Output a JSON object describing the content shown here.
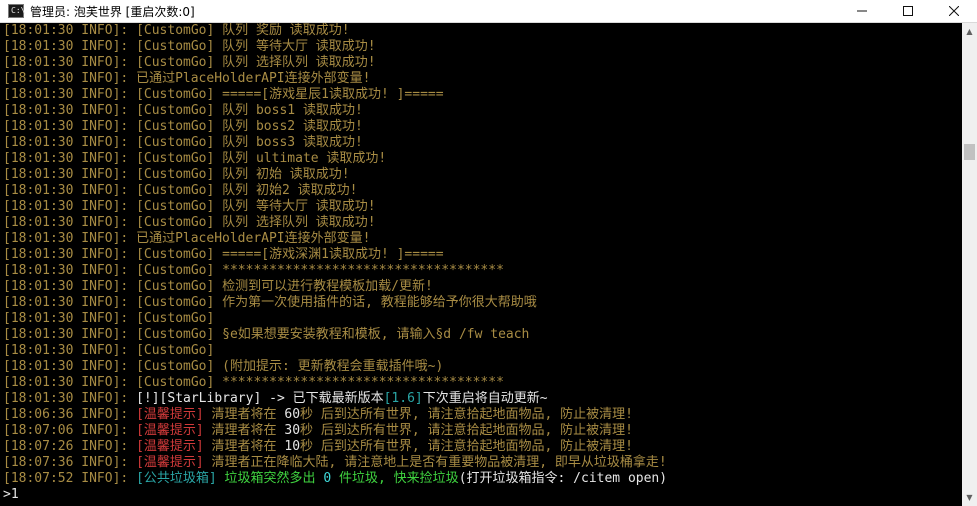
{
  "window": {
    "title": "管理员:  泡芙世界 [重启次数:0]",
    "icon": "cmd-console-icon",
    "controls": [
      "minimize",
      "maximize",
      "close"
    ]
  },
  "colors": {
    "timestamp": "#a88c44",
    "gold": "#a88c44",
    "white": "#e6e6e6",
    "cyan": "#2aa6a6",
    "green": "#3fd23f",
    "red": "#d03a3a",
    "bright_cyan": "#3fd8d8"
  },
  "console": {
    "lines": [
      {
        "ts": "[18:01:30 INFO]: ",
        "segs": [
          {
            "t": "[CustomGo] 队列 奖励 读取成功!",
            "c": "gold"
          }
        ]
      },
      {
        "ts": "[18:01:30 INFO]: ",
        "segs": [
          {
            "t": "[CustomGo] 队列 等待大厅 读取成功!",
            "c": "gold"
          }
        ]
      },
      {
        "ts": "[18:01:30 INFO]: ",
        "segs": [
          {
            "t": "[CustomGo] 队列 选择队列 读取成功!",
            "c": "gold"
          }
        ]
      },
      {
        "ts": "[18:01:30 INFO]: ",
        "segs": [
          {
            "t": "已通过PlaceHolderAPI连接外部变量!",
            "c": "gold"
          }
        ]
      },
      {
        "ts": "[18:01:30 INFO]: ",
        "segs": [
          {
            "t": "[CustomGo] =====[游戏星辰1读取成功! ]=====",
            "c": "gold"
          }
        ]
      },
      {
        "ts": "[18:01:30 INFO]: ",
        "segs": [
          {
            "t": "[CustomGo] 队列 boss1 读取成功!",
            "c": "gold"
          }
        ]
      },
      {
        "ts": "[18:01:30 INFO]: ",
        "segs": [
          {
            "t": "[CustomGo] 队列 boss2 读取成功!",
            "c": "gold"
          }
        ]
      },
      {
        "ts": "[18:01:30 INFO]: ",
        "segs": [
          {
            "t": "[CustomGo] 队列 boss3 读取成功!",
            "c": "gold"
          }
        ]
      },
      {
        "ts": "[18:01:30 INFO]: ",
        "segs": [
          {
            "t": "[CustomGo] 队列 ultimate 读取成功!",
            "c": "gold"
          }
        ]
      },
      {
        "ts": "[18:01:30 INFO]: ",
        "segs": [
          {
            "t": "[CustomGo] 队列 初始 读取成功!",
            "c": "gold"
          }
        ]
      },
      {
        "ts": "[18:01:30 INFO]: ",
        "segs": [
          {
            "t": "[CustomGo] 队列 初始2 读取成功!",
            "c": "gold"
          }
        ]
      },
      {
        "ts": "[18:01:30 INFO]: ",
        "segs": [
          {
            "t": "[CustomGo] 队列 等待大厅 读取成功!",
            "c": "gold"
          }
        ]
      },
      {
        "ts": "[18:01:30 INFO]: ",
        "segs": [
          {
            "t": "[CustomGo] 队列 选择队列 读取成功!",
            "c": "gold"
          }
        ]
      },
      {
        "ts": "[18:01:30 INFO]: ",
        "segs": [
          {
            "t": "已通过PlaceHolderAPI连接外部变量!",
            "c": "gold"
          }
        ]
      },
      {
        "ts": "[18:01:30 INFO]: ",
        "segs": [
          {
            "t": "[CustomGo] =====[游戏深渊1读取成功! ]=====",
            "c": "gold"
          }
        ]
      },
      {
        "ts": "[18:01:30 INFO]: ",
        "segs": [
          {
            "t": "[CustomGo] ",
            "c": "gold"
          },
          {
            "t": "************************************",
            "c": "gold"
          }
        ]
      },
      {
        "ts": "[18:01:30 INFO]: ",
        "segs": [
          {
            "t": "[CustomGo] ",
            "c": "gold"
          },
          {
            "t": "检测到可以进行教程模板加载/更新!",
            "c": "gold"
          }
        ]
      },
      {
        "ts": "[18:01:30 INFO]: ",
        "segs": [
          {
            "t": "[CustomGo] ",
            "c": "gold"
          },
          {
            "t": "作为第一次使用插件的话, 教程能够给予你很大帮助哦",
            "c": "gold"
          }
        ]
      },
      {
        "ts": "[18:01:30 INFO]: ",
        "segs": [
          {
            "t": "[CustomGo]",
            "c": "gold"
          }
        ]
      },
      {
        "ts": "[18:01:30 INFO]: ",
        "segs": [
          {
            "t": "[CustomGo] ",
            "c": "gold"
          },
          {
            "t": "§e如果想要安装教程和模板, 请输入§d /fw teach",
            "c": "gold"
          }
        ]
      },
      {
        "ts": "[18:01:30 INFO]: ",
        "segs": [
          {
            "t": "[CustomGo]",
            "c": "gold"
          }
        ]
      },
      {
        "ts": "[18:01:30 INFO]: ",
        "segs": [
          {
            "t": "[CustomGo] ",
            "c": "gold"
          },
          {
            "t": "(附加提示: 更新教程会重载插件哦~)",
            "c": "gold"
          }
        ]
      },
      {
        "ts": "[18:01:30 INFO]: ",
        "segs": [
          {
            "t": "[CustomGo] ",
            "c": "gold"
          },
          {
            "t": "************************************",
            "c": "gold"
          }
        ]
      },
      {
        "ts": "[18:01:30 INFO]: ",
        "segs": [
          {
            "t": "[!][StarLibrary] -> 已下载最新版本",
            "c": "white"
          },
          {
            "t": "[1.6]",
            "c": "cyan"
          },
          {
            "t": "下次重启将自动更新~",
            "c": "white"
          }
        ]
      },
      {
        "ts": "[18:06:36 INFO]: ",
        "segs": [
          {
            "t": "[温馨提示]",
            "c": "red"
          },
          {
            "t": " 清理者将在 ",
            "c": "gold"
          },
          {
            "t": "60",
            "c": "white"
          },
          {
            "t": "秒 后到达所有世界, 请注意拾起地面物品, 防止被清理!",
            "c": "gold"
          }
        ]
      },
      {
        "ts": "[18:07:06 INFO]: ",
        "segs": [
          {
            "t": "[温馨提示]",
            "c": "red"
          },
          {
            "t": " 清理者将在 ",
            "c": "gold"
          },
          {
            "t": "30",
            "c": "white"
          },
          {
            "t": "秒 后到达所有世界, 请注意拾起地面物品, 防止被清理!",
            "c": "gold"
          }
        ]
      },
      {
        "ts": "[18:07:26 INFO]: ",
        "segs": [
          {
            "t": "[温馨提示]",
            "c": "red"
          },
          {
            "t": " 清理者将在 ",
            "c": "gold"
          },
          {
            "t": "10",
            "c": "white"
          },
          {
            "t": "秒 后到达所有世界, 请注意拾起地面物品, 防止被清理!",
            "c": "gold"
          }
        ]
      },
      {
        "ts": "[18:07:36 INFO]: ",
        "segs": [
          {
            "t": "[温馨提示]",
            "c": "red"
          },
          {
            "t": " 清理者正在降临大陆, 请注意地上是否有重要物品被清理, 即早从垃圾桶拿走!",
            "c": "gold"
          }
        ]
      },
      {
        "ts": "[18:07:52 INFO]: ",
        "segs": [
          {
            "t": "[公共垃圾箱]",
            "c": "cyan"
          },
          {
            "t": " 垃圾箱突然多出 ",
            "c": "green"
          },
          {
            "t": "0",
            "c": "bright_cyan"
          },
          {
            "t": " 件垃圾, 快来捡垃圾",
            "c": "green"
          },
          {
            "t": "(打开垃圾箱指令: /citem open)",
            "c": "white"
          }
        ]
      }
    ],
    "prompt": ">1"
  }
}
